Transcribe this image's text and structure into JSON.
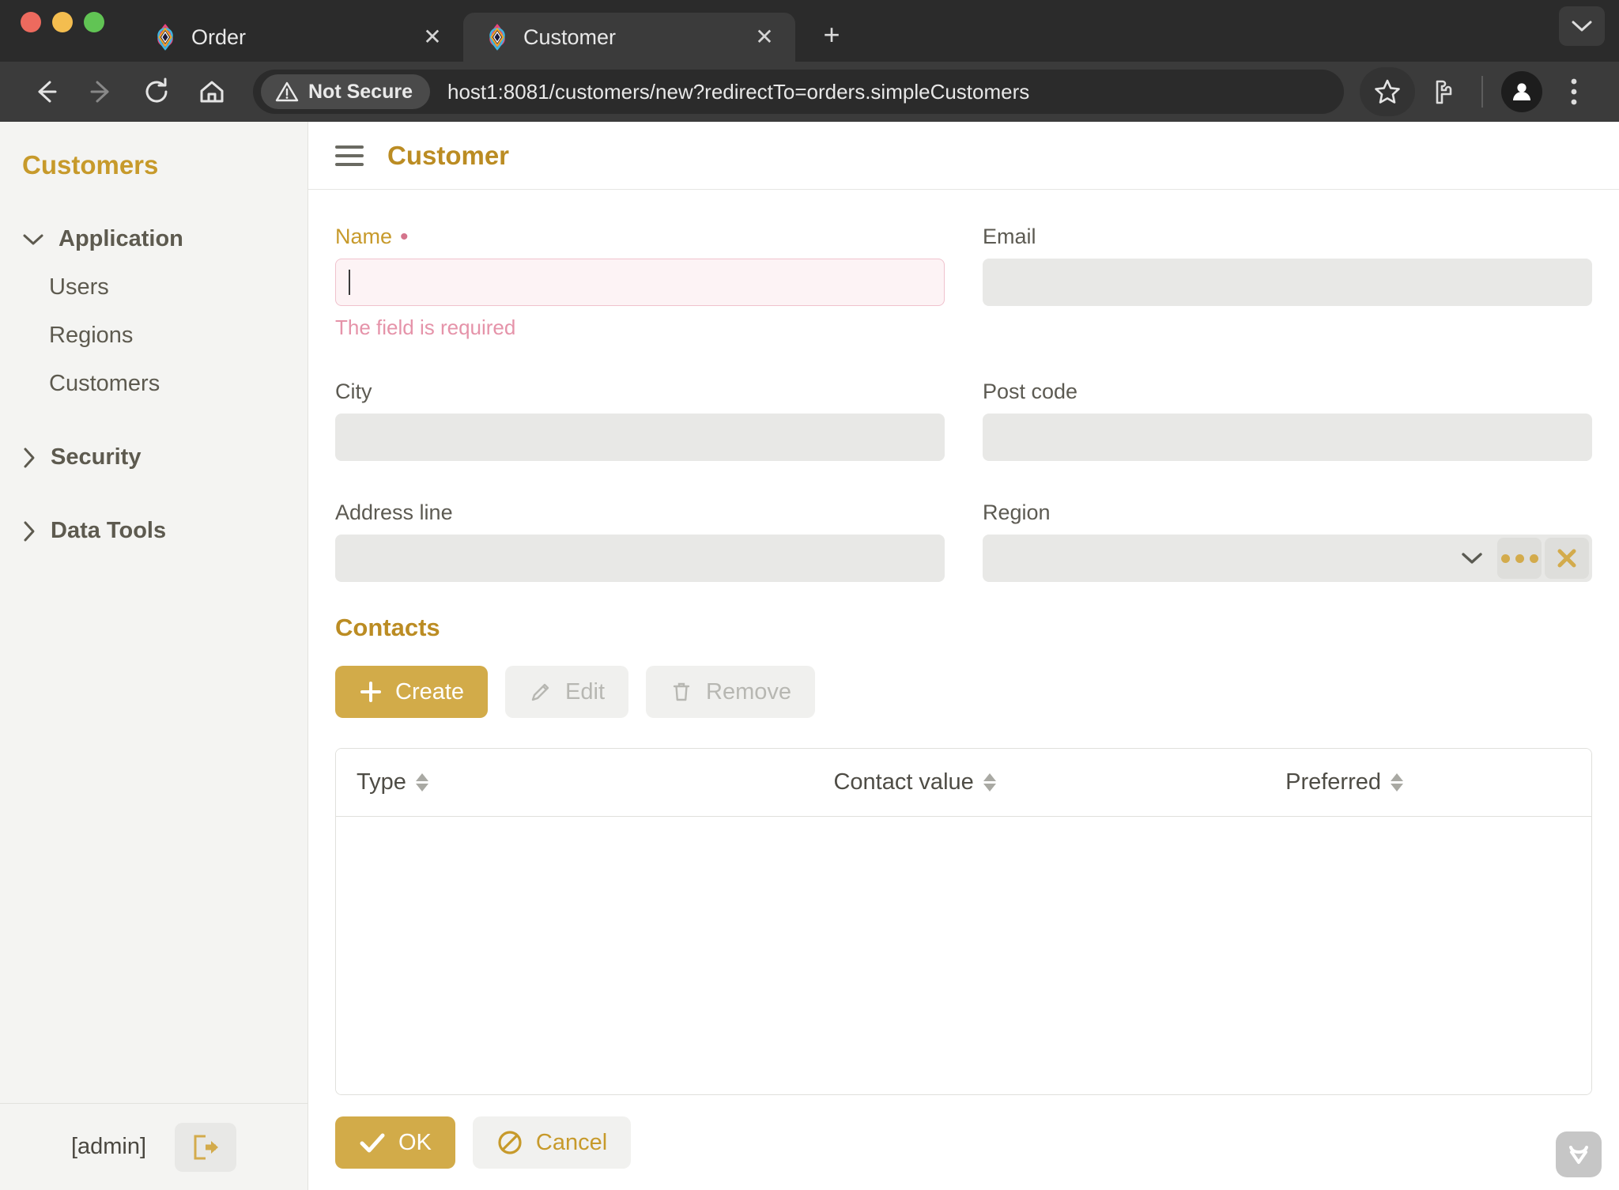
{
  "browser": {
    "tabs": [
      {
        "title": "Order",
        "active": false,
        "favicon": "app-logo-icon",
        "close": "✕"
      },
      {
        "title": "Customer",
        "active": true,
        "favicon": "app-logo-icon",
        "close": "✕"
      }
    ],
    "new_tab_label": "+",
    "security_label": "Not Secure",
    "url": "host1:8081/customers/new?redirectTo=orders.simpleCustomers",
    "icons": {
      "back": "back-arrow-icon",
      "forward": "forward-arrow-icon",
      "reload": "reload-icon",
      "home": "home-icon",
      "bookmark": "star-icon",
      "extensions": "puzzle-piece-icon",
      "profile": "person-avatar-icon",
      "menu": "three-dot-menu-icon",
      "tab_list": "chevron-down-icon"
    }
  },
  "sidebar": {
    "title": "Customers",
    "groups": [
      {
        "label": "Application",
        "expanded": true,
        "items": [
          {
            "label": "Users"
          },
          {
            "label": "Regions"
          },
          {
            "label": "Customers"
          }
        ]
      },
      {
        "label": "Security",
        "expanded": false,
        "items": []
      },
      {
        "label": "Data Tools",
        "expanded": false,
        "items": []
      }
    ],
    "footer": {
      "user": "[admin]",
      "logout_icon": "logout-icon"
    }
  },
  "header": {
    "menu_icon": "hamburger-menu-icon",
    "title": "Customer"
  },
  "form": {
    "fields": {
      "name": {
        "label": "Name",
        "required_marker": "•",
        "value": "",
        "error": "The field is required",
        "focused": true
      },
      "email": {
        "label": "Email",
        "value": ""
      },
      "city": {
        "label": "City",
        "value": ""
      },
      "post_code": {
        "label": "Post code",
        "value": ""
      },
      "address_line": {
        "label": "Address line",
        "value": ""
      },
      "region": {
        "label": "Region",
        "value": "",
        "dropdown_icon": "chevron-down-icon",
        "lookup_icon": "ellipsis-icon",
        "clear_icon": "close-x-icon"
      }
    }
  },
  "contacts": {
    "section_title": "Contacts",
    "buttons": [
      {
        "label": "Create",
        "icon": "plus-icon",
        "state": "enabled"
      },
      {
        "label": "Edit",
        "icon": "pencil-icon",
        "state": "disabled"
      },
      {
        "label": "Remove",
        "icon": "trash-icon",
        "state": "disabled"
      }
    ],
    "table": {
      "columns": [
        {
          "label": "Type",
          "sortable": true
        },
        {
          "label": "Contact value",
          "sortable": true
        },
        {
          "label": "Preferred",
          "sortable": true
        }
      ],
      "rows": []
    }
  },
  "footer": {
    "ok_label": "OK",
    "ok_icon": "check-icon",
    "cancel_label": "Cancel",
    "cancel_icon": "ban-circle-icon"
  },
  "colors": {
    "accent_gold": "#c79a2b",
    "button_gold": "#d2ab49",
    "error_pink": "#e593a9",
    "input_gray": "#e8e8e6",
    "sidebar_bg": "#f4f4f2"
  }
}
